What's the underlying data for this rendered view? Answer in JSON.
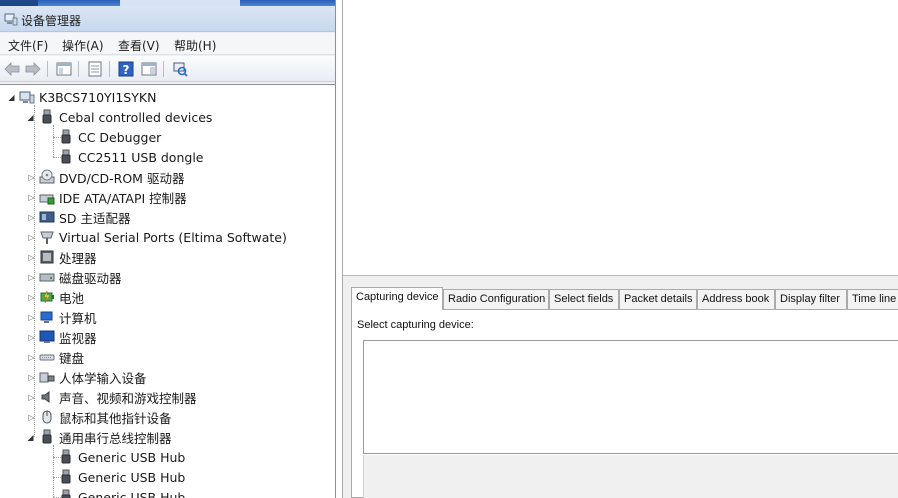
{
  "device_manager": {
    "title": "设备管理器",
    "menu": [
      {
        "label": "文件(F)"
      },
      {
        "label": "操作(A)"
      },
      {
        "label": "查看(V)"
      },
      {
        "label": "帮助(H)"
      }
    ],
    "toolbar": [
      {
        "icon": "back-arrow-icon"
      },
      {
        "icon": "forward-arrow-icon"
      },
      {
        "icon": "show-hide-console-tree-icon"
      },
      {
        "icon": "properties-icon"
      },
      {
        "icon": "help-icon"
      },
      {
        "icon": "show-action-pane-icon"
      },
      {
        "icon": "scan-hardware-changes-icon"
      }
    ],
    "tree": {
      "root": "K3BCS710YI1SYKN",
      "nodes": [
        {
          "label": "Cebal controlled devices",
          "icon": "usb-plug-icon",
          "expanded": true
        },
        {
          "label": "CC Debugger",
          "icon": "usb-plug-icon",
          "child": true
        },
        {
          "label": "CC2511 USB dongle",
          "icon": "usb-plug-icon",
          "child": true
        },
        {
          "label": "DVD/CD-ROM 驱动器",
          "icon": "dvd-drive-icon"
        },
        {
          "label": "IDE ATA/ATAPI 控制器",
          "icon": "ide-controller-icon"
        },
        {
          "label": "SD 主适配器",
          "icon": "sd-adapter-icon"
        },
        {
          "label": "Virtual Serial Ports (Eltima Softwate)",
          "icon": "serial-port-icon"
        },
        {
          "label": "处理器",
          "icon": "processor-icon"
        },
        {
          "label": "磁盘驱动器",
          "icon": "disk-drive-icon"
        },
        {
          "label": "电池",
          "icon": "battery-icon"
        },
        {
          "label": "计算机",
          "icon": "computer-icon"
        },
        {
          "label": "监视器",
          "icon": "monitor-icon"
        },
        {
          "label": "键盘",
          "icon": "keyboard-icon"
        },
        {
          "label": "人体学输入设备",
          "icon": "hid-icon"
        },
        {
          "label": "声音、视频和游戏控制器",
          "icon": "speaker-icon"
        },
        {
          "label": "鼠标和其他指针设备",
          "icon": "mouse-icon"
        },
        {
          "label": "通用串行总线控制器",
          "icon": "usb-plug-icon",
          "expanded": true
        },
        {
          "label": "Generic USB Hub",
          "icon": "usb-plug-icon",
          "child": true
        },
        {
          "label": "Generic USB Hub",
          "icon": "usb-plug-icon",
          "child": true
        },
        {
          "label": "Generic USB Hub",
          "icon": "usb-plug-icon",
          "child": true
        }
      ]
    }
  },
  "packet_sniffer": {
    "tabs": [
      {
        "label": "Capturing device",
        "active": true
      },
      {
        "label": "Radio Configuration"
      },
      {
        "label": "Select fields"
      },
      {
        "label": "Packet details"
      },
      {
        "label": "Address book"
      },
      {
        "label": "Display filter"
      },
      {
        "label": "Time line"
      }
    ],
    "select_label": "Select capturing device:"
  }
}
